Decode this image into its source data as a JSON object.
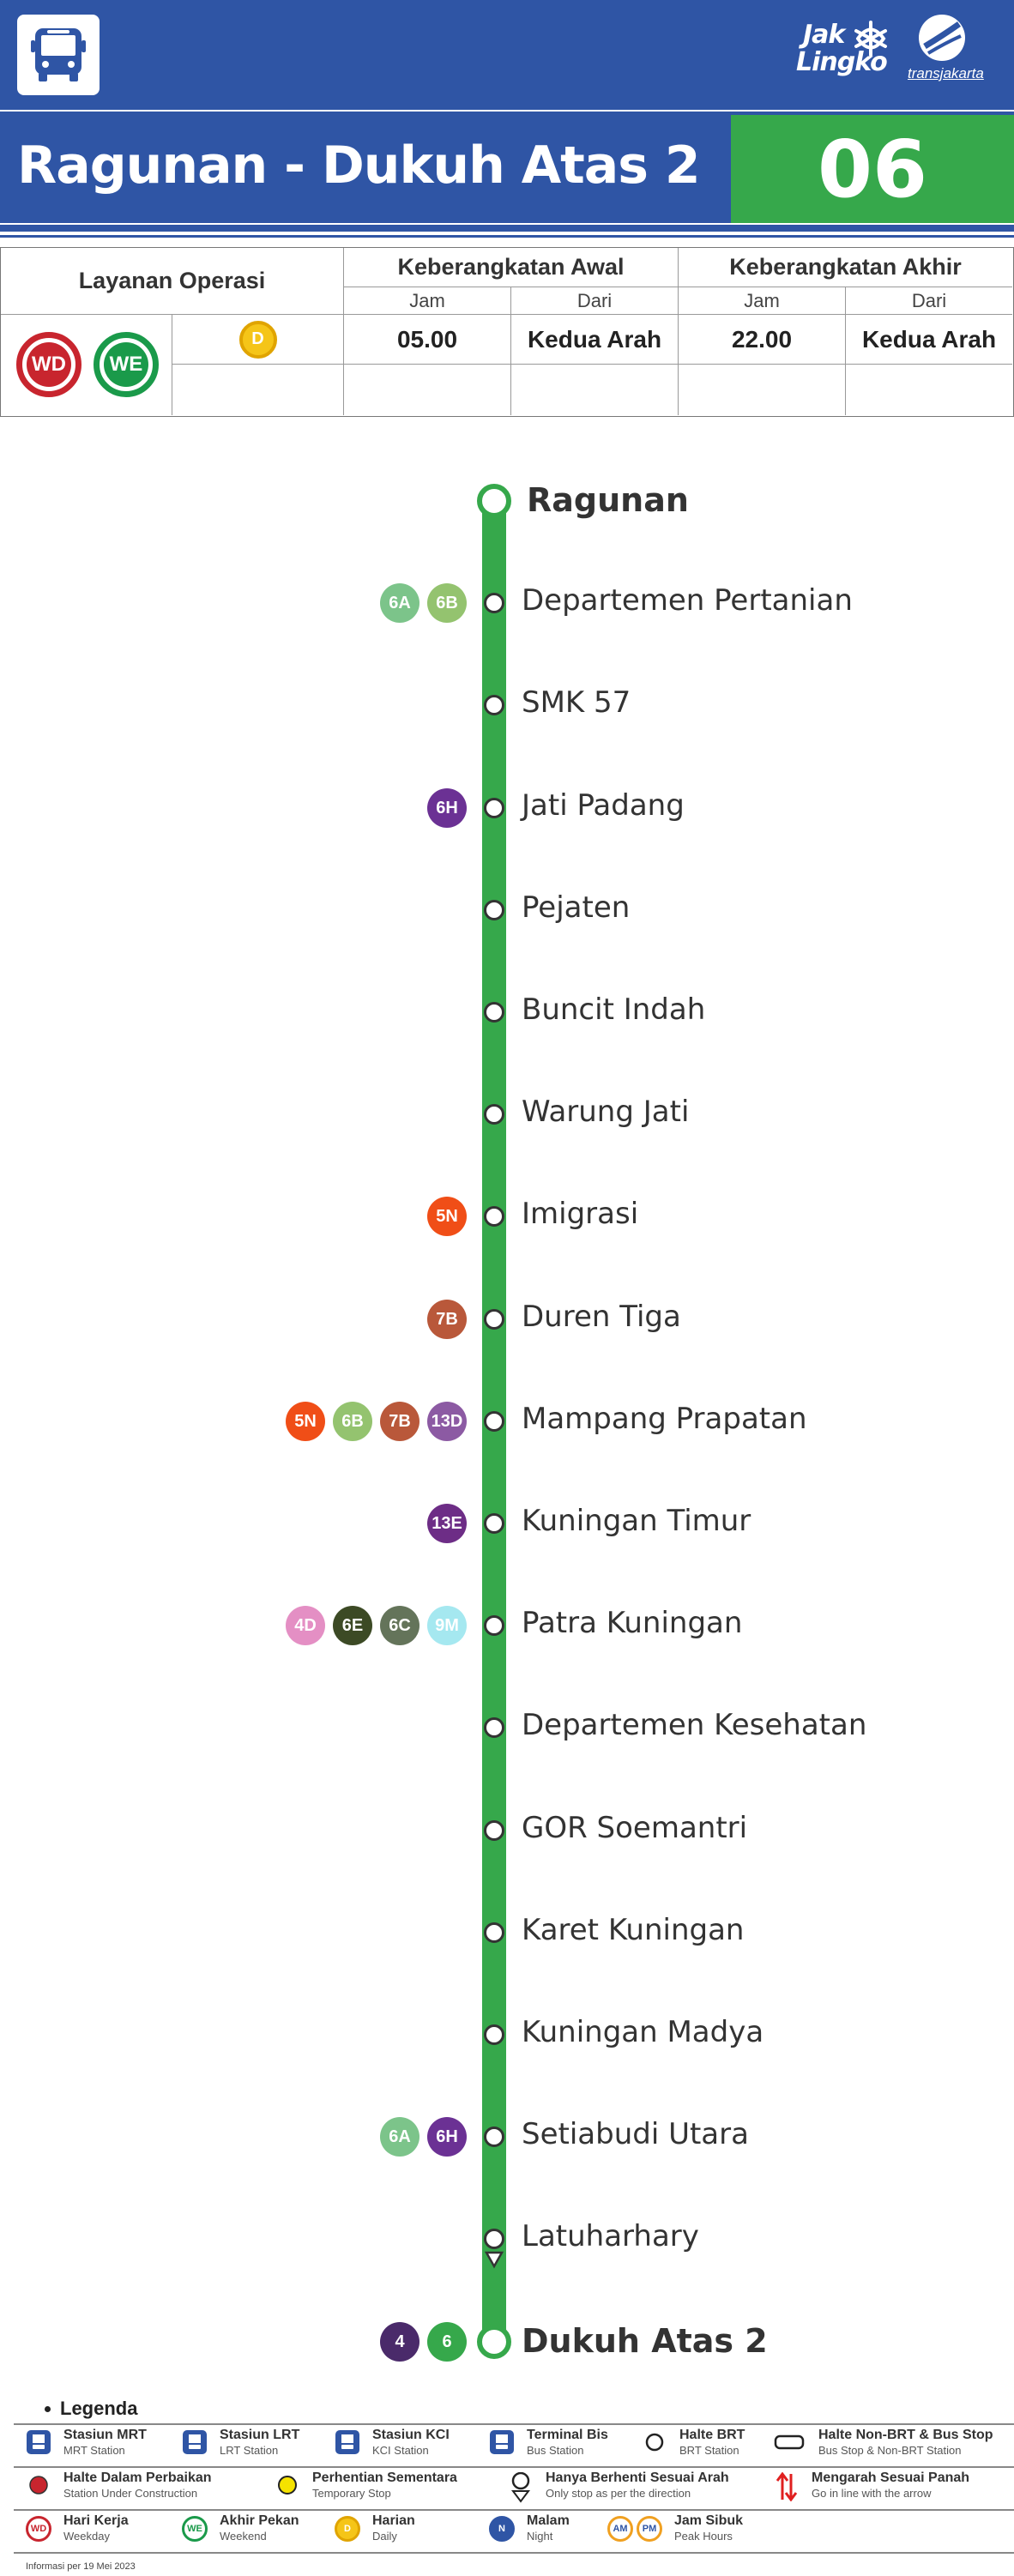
{
  "header": {
    "brand_line1": "Jak",
    "brand_line2": "Lingko",
    "operator": "transjakarta"
  },
  "route": {
    "title": "Ragunan - Dukuh Atas 2",
    "code": "06"
  },
  "schedule": {
    "col_service": "Layanan Operasi",
    "col_first": "Keberangkatan Awal",
    "col_last": "Keberangkatan Akhir",
    "sub_time": "Jam",
    "sub_from": "Dari",
    "badge_weekday": "WD",
    "badge_weekend": "WE",
    "badge_daily": "D",
    "first_time": "05.00",
    "first_from": "Kedua Arah",
    "last_time": "22.00",
    "last_from": "Kedua Arah"
  },
  "stops": [
    {
      "name": "Ragunan",
      "terminal": true,
      "connections": []
    },
    {
      "name": "Departemen Pertanian",
      "terminal": false,
      "connections": [
        {
          "code": "6A",
          "color": "#7cc48a"
        },
        {
          "code": "6B",
          "color": "#94c36f"
        }
      ]
    },
    {
      "name": "SMK 57",
      "terminal": false,
      "connections": []
    },
    {
      "name": "Jati Padang",
      "terminal": false,
      "connections": [
        {
          "code": "6H",
          "color": "#6b3194"
        }
      ]
    },
    {
      "name": "Pejaten",
      "terminal": false,
      "connections": []
    },
    {
      "name": "Buncit Indah",
      "terminal": false,
      "connections": []
    },
    {
      "name": "Warung Jati",
      "terminal": false,
      "connections": []
    },
    {
      "name": "Imigrasi",
      "terminal": false,
      "connections": [
        {
          "code": "5N",
          "color": "#f04e17"
        }
      ]
    },
    {
      "name": "Duren Tiga",
      "terminal": false,
      "connections": [
        {
          "code": "7B",
          "color": "#b9583a"
        }
      ]
    },
    {
      "name": "Mampang Prapatan",
      "terminal": false,
      "connections": [
        {
          "code": "5N",
          "color": "#f04e17"
        },
        {
          "code": "6B",
          "color": "#94c36f"
        },
        {
          "code": "7B",
          "color": "#b9583a"
        },
        {
          "code": "13D",
          "color": "#8c5aa3"
        }
      ]
    },
    {
      "name": "Kuningan Timur",
      "terminal": false,
      "connections": [
        {
          "code": "13E",
          "color": "#6d2d86"
        }
      ]
    },
    {
      "name": "Patra Kuningan",
      "terminal": false,
      "connections": [
        {
          "code": "4D",
          "color": "#e48fc4"
        },
        {
          "code": "6E",
          "color": "#3c4a25"
        },
        {
          "code": "6C",
          "color": "#64745a"
        },
        {
          "code": "9M",
          "color": "#a5e8f0"
        }
      ]
    },
    {
      "name": "Departemen Kesehatan",
      "terminal": false,
      "connections": []
    },
    {
      "name": "GOR Soemantri",
      "terminal": false,
      "connections": []
    },
    {
      "name": "Karet Kuningan",
      "terminal": false,
      "connections": []
    },
    {
      "name": "Kuningan Madya",
      "terminal": false,
      "connections": []
    },
    {
      "name": "Setiabudi Utara",
      "terminal": false,
      "connections": [
        {
          "code": "6A",
          "color": "#7cc48a"
        },
        {
          "code": "6H",
          "color": "#6b3194"
        }
      ]
    },
    {
      "name": "Latuharhary",
      "terminal": false,
      "connections": []
    },
    {
      "name": "Dukuh Atas 2",
      "terminal": true,
      "connections": [
        {
          "code": "4",
          "color": "#4a2a6a"
        },
        {
          "code": "6",
          "color": "#36a84b"
        }
      ]
    }
  ],
  "legend": {
    "title": "Legenda",
    "items": [
      {
        "main": "Stasiun MRT",
        "en": "MRT Station",
        "icon": "mrt-icon"
      },
      {
        "main": "Stasiun LRT",
        "en": "LRT Station",
        "icon": "lrt-icon"
      },
      {
        "main": "Stasiun KCI",
        "en": "KCI Station",
        "icon": "kci-icon"
      },
      {
        "main": "Terminal Bis",
        "en": "Bus Station",
        "icon": "bus-terminal-icon"
      },
      {
        "main": "Halte BRT",
        "en": "BRT Station",
        "icon": "brt-stop-icon"
      },
      {
        "main": "Halte Non-BRT & Bus Stop",
        "en": "Bus Stop & Non-BRT Station",
        "icon": "non-brt-stop-icon"
      },
      {
        "main": "Halte Dalam Perbaikan",
        "en": "Station Under Construction",
        "icon": "construction-icon"
      },
      {
        "main": "Perhentian Sementara",
        "en": "Temporary Stop",
        "icon": "temporary-stop-icon"
      },
      {
        "main": "Hanya Berhenti Sesuai Arah",
        "en": "Only stop as per the direction",
        "icon": "direction-stop-icon"
      },
      {
        "main": "Mengarah Sesuai Panah",
        "en": "Go in line with the arrow",
        "icon": "arrow-direction-icon"
      },
      {
        "main": "Hari Kerja",
        "en": "Weekday",
        "icon": "weekday-icon",
        "badge": "WD"
      },
      {
        "main": "Akhir Pekan",
        "en": "Weekend",
        "icon": "weekend-icon",
        "badge": "WE"
      },
      {
        "main": "Harian",
        "en": "Daily",
        "icon": "daily-icon",
        "badge": "D"
      },
      {
        "main": "Malam",
        "en": "Night",
        "icon": "night-icon",
        "badge": "N"
      },
      {
        "main": "Jam Sibuk",
        "en": "Peak Hours",
        "icon": "peak-hours-icon",
        "badge_am": "AM",
        "badge_pm": "PM"
      }
    ]
  },
  "footnote": "Informasi per 19 Mei 2023",
  "colors": {
    "brand_blue": "#2f55a5",
    "route_green": "#36a84b",
    "weekday_red": "#c8252e",
    "weekend_green": "#1a9a4a",
    "daily_yellow": "#f5c518"
  }
}
